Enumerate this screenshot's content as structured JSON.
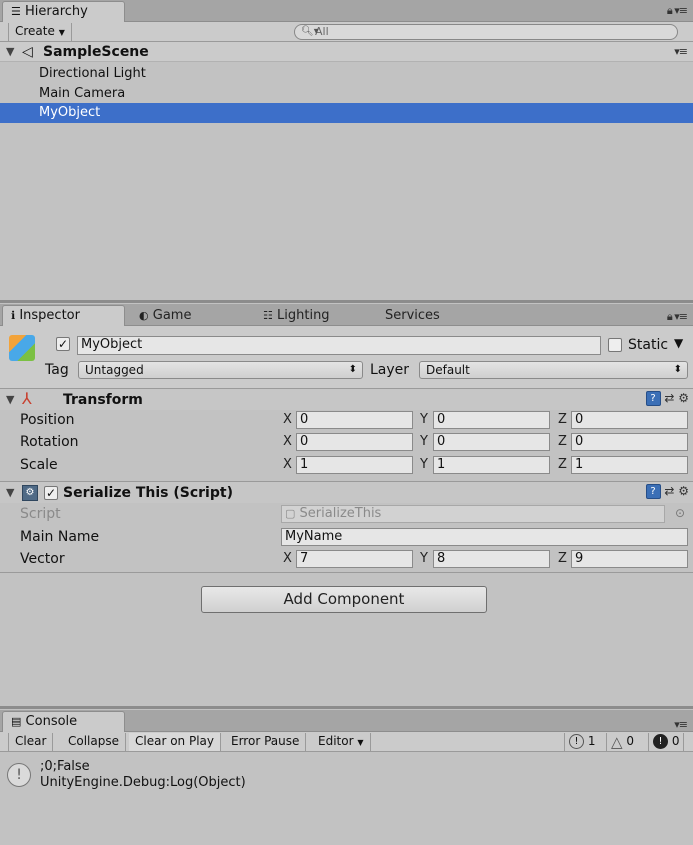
{
  "hierarchy": {
    "tab_label": "Hierarchy",
    "create_label": "Create",
    "search_placeholder": "All",
    "scene_name": "SampleScene",
    "items": [
      {
        "label": "Directional Light"
      },
      {
        "label": "Main Camera"
      },
      {
        "label": "MyObject",
        "selected": true
      }
    ]
  },
  "inspector_tabs": [
    {
      "label": "Inspector",
      "active": true
    },
    {
      "label": "Game"
    },
    {
      "label": "Lighting"
    },
    {
      "label": "Services"
    }
  ],
  "inspector": {
    "object_name": "MyObject",
    "active": true,
    "static_label": "Static",
    "tag_label": "Tag",
    "tag_value": "Untagged",
    "layer_label": "Layer",
    "layer_value": "Default",
    "transform": {
      "title": "Transform",
      "position_label": "Position",
      "rotation_label": "Rotation",
      "scale_label": "Scale",
      "position": {
        "x": "0",
        "y": "0",
        "z": "0"
      },
      "rotation": {
        "x": "0",
        "y": "0",
        "z": "0"
      },
      "scale": {
        "x": "1",
        "y": "1",
        "z": "1"
      }
    },
    "script_component": {
      "title": "Serialize This (Script)",
      "enabled": true,
      "script_label": "Script",
      "script_value": "SerializeThis",
      "main_name_label": "Main Name",
      "main_name_value": "MyName",
      "vector_label": "Vector",
      "vector": {
        "x": "7",
        "y": "8",
        "z": "9"
      }
    },
    "axis_labels": {
      "x": "X",
      "y": "Y",
      "z": "Z"
    },
    "add_component_label": "Add Component"
  },
  "console": {
    "tab_label": "Console",
    "buttons": {
      "clear": "Clear",
      "collapse": "Collapse",
      "clear_on_play": "Clear on Play",
      "error_pause": "Error Pause",
      "editor": "Editor"
    },
    "counts": {
      "info": "1",
      "warnings": "0",
      "errors": "0"
    },
    "log": {
      "line1": ";0;False",
      "line2": "UnityEngine.Debug:Log(Object)"
    }
  },
  "colors": {
    "selection": "#3d6fc9",
    "panel_bg": "#c2c2c2",
    "tab_bar": "#a5a5a5"
  },
  "icons": [
    "hierarchy-list-icon",
    "search-icon",
    "unity-scene-icon",
    "info-icon",
    "game-icon",
    "lighting-icon",
    "lock-icon",
    "panel-menu-icon",
    "gameobject-cube-icon",
    "transform-axes-icon",
    "script-icon",
    "help-book-icon",
    "preset-icon",
    "gear-icon",
    "object-picker-icon",
    "console-icon",
    "warning-icon",
    "error-icon"
  ]
}
